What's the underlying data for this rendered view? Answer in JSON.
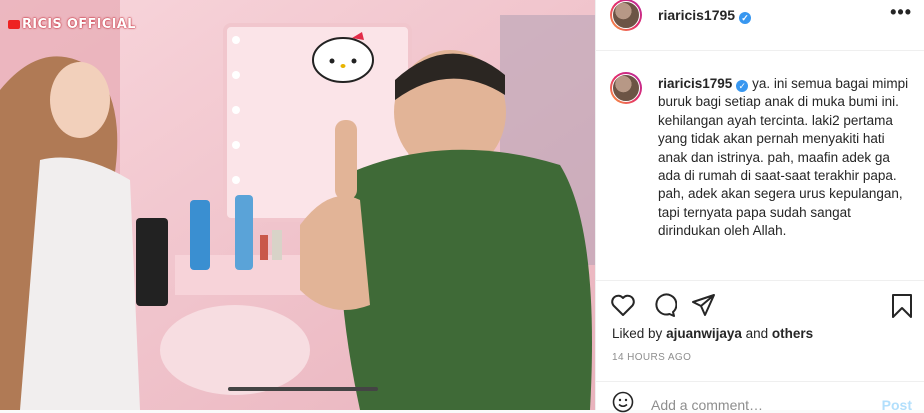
{
  "media": {
    "watermark": "RICIS OFFICIAL"
  },
  "header": {
    "username": "riaricis1795",
    "more_icon": "more-horizontal-icon"
  },
  "caption": {
    "username": "riaricis1795",
    "text": "ya. ini semua bagai mimpi buruk bagi setiap anak di muka bumi ini. kehilangan ayah tercinta. laki2 pertama yang tidak akan pernah menyakiti hati anak dan istrinya. pah, maafin adek ga ada di rumah di saat-saat terakhir papa. pah, adek akan segera urus kepulangan, tapi ternyata papa sudah sangat dirindukan oleh Allah."
  },
  "actions": {
    "icons": [
      "heart-icon",
      "comment-icon",
      "share-icon",
      "bookmark-icon"
    ]
  },
  "likes": {
    "prefix": "Liked by",
    "user": "ajuanwijaya",
    "connector": "and",
    "others": "others"
  },
  "timestamp": "14 HOURS AGO",
  "comment_box": {
    "placeholder": "Add a comment…",
    "post_label": "Post"
  },
  "colors": {
    "accent": "#3897f0",
    "post_disabled": "#b2dffc",
    "muted": "#8e8e8e"
  }
}
